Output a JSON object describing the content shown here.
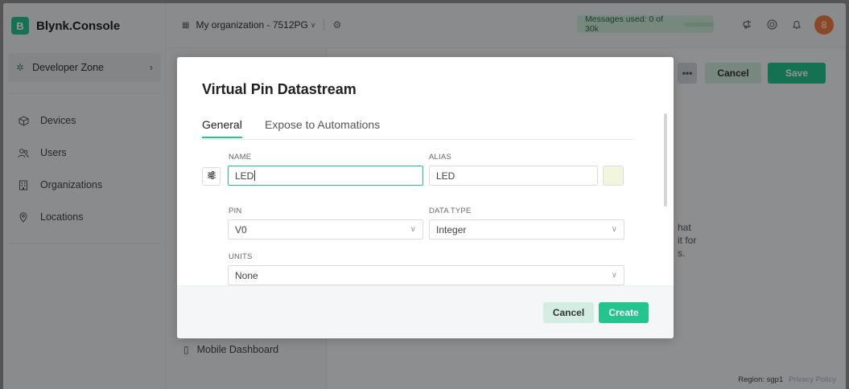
{
  "brand": {
    "logo": "B",
    "name": "Blynk.Console"
  },
  "sidebar": {
    "developer_zone": "Developer Zone",
    "items": [
      {
        "label": "Devices",
        "icon": "cube-icon"
      },
      {
        "label": "Users",
        "icon": "users-icon"
      },
      {
        "label": "Organizations",
        "icon": "building-icon"
      },
      {
        "label": "Locations",
        "icon": "map-pin-icon"
      }
    ]
  },
  "topbar": {
    "organization": "My organization - 7512PG",
    "messages_used": "Messages used: 0 of 30k",
    "avatar_initial": "8"
  },
  "subpanel": {
    "mobile_dashboard": "Mobile Dashboard"
  },
  "header_buttons": {
    "more": "•••",
    "cancel": "Cancel",
    "save": "Save"
  },
  "background_text": {
    "line1": "hat",
    "line2": "it for",
    "line3": "s."
  },
  "footer": {
    "region": "Region: sgp1",
    "privacy": "Privacy Policy"
  },
  "modal": {
    "title": "Virtual Pin Datastream",
    "tabs": [
      "General",
      "Expose to Automations"
    ],
    "name": {
      "label": "NAME",
      "value": "LED"
    },
    "alias": {
      "label": "ALIAS",
      "value": "LED"
    },
    "pin": {
      "label": "PIN",
      "value": "V0"
    },
    "data_type": {
      "label": "DATA TYPE",
      "value": "Integer"
    },
    "units": {
      "label": "UNITS",
      "value": "None"
    },
    "cancel": "Cancel",
    "create": "Create",
    "swatch_color": "#f1f6dd"
  },
  "colors": {
    "accent": "#23c48e",
    "avatar": "#ef7d45"
  }
}
